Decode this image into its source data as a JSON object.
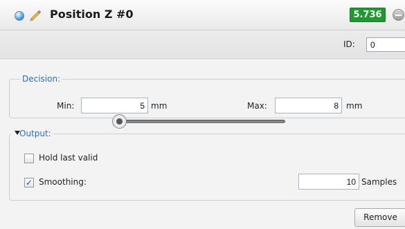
{
  "header": {
    "title": "Position Z #0",
    "value": "5.736",
    "status_icon": "blue-orb-icon",
    "edit_icon": "pencil-icon",
    "collapse_icon": "minus-circle-icon",
    "value_color": "#1f9a2e"
  },
  "id_bar": {
    "label": "ID:",
    "value": "0"
  },
  "decision": {
    "legend": "Decision:",
    "min_label": "Min:",
    "min_value": "5",
    "min_unit": "mm",
    "max_label": "Max:",
    "max_value": "8",
    "max_unit": "mm"
  },
  "output": {
    "legend": "Output:",
    "hold_last_valid": {
      "label": "Hold last valid",
      "checked": false
    },
    "smoothing": {
      "label": "Smoothing:",
      "checked": true,
      "mark": "✓",
      "samples_value": "10",
      "samples_unit": "Samples",
      "slider_level": 0
    }
  },
  "actions": {
    "remove_label": "Remove"
  }
}
